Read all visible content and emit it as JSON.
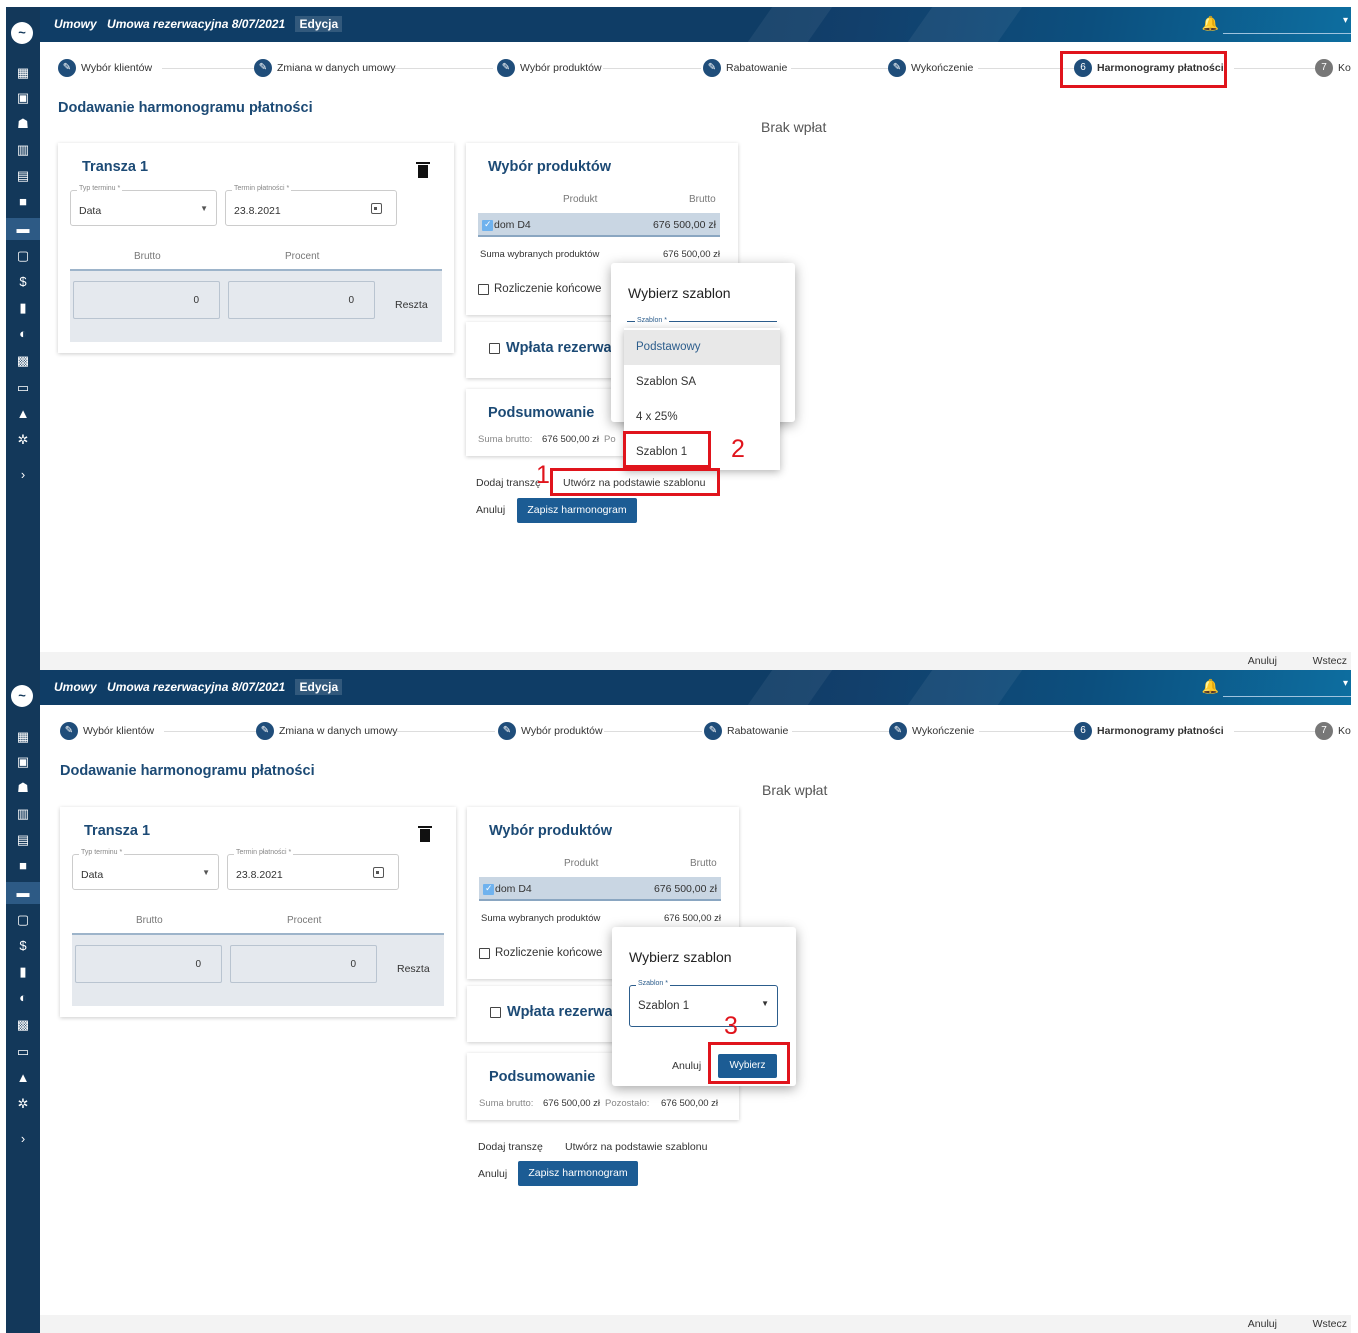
{
  "breadcrumb": {
    "root": "Umowy",
    "contract": "Umowa rezerwacyjna 8/07/2021",
    "mode": "Edycja"
  },
  "stepper": {
    "steps": [
      "Wybór klientów",
      "Zmiana w danych umowy",
      "Wybór produktów",
      "Rabatowanie",
      "Wykończenie",
      "Harmonogramy płatności",
      "Ko"
    ],
    "current_number": "6",
    "next_number": "7"
  },
  "page": {
    "title": "Dodawanie harmonogramu płatności",
    "no_payments": "Brak wpłat"
  },
  "tranche": {
    "title": "Transza 1",
    "term_type_label": "Typ terminu *",
    "term_type_value": "Data",
    "due_date_label": "Termin płatności *",
    "due_date_value": "23.8.2021",
    "col_brutto": "Brutto",
    "col_procent": "Procent",
    "brutto_value": "0",
    "procent_value": "0",
    "reszta_label": "Reszta"
  },
  "products": {
    "title": "Wybór produktów",
    "col_product": "Produkt",
    "col_brutto": "Brutto",
    "row_name": "dom D4",
    "row_value": "676 500,00 zł",
    "sum_label": "Suma wybranych produktów",
    "sum_value": "676 500,00 zł",
    "final_settlement": "Rozliczenie końcowe"
  },
  "reservation": {
    "title": "Wpłata rezerwa"
  },
  "summary": {
    "title": "Podsumowanie",
    "gross_label": "Suma brutto:",
    "gross_value": "676 500,00 zł",
    "remaining_label": "Pozostało:",
    "remaining_value": "676 500,00 zł",
    "remaining_label_cut": "Po"
  },
  "actions": {
    "add_tranche": "Dodaj transzę",
    "from_template": "Utwórz na podstawie szablonu",
    "cancel": "Anuluj",
    "save": "Zapisz harmonogram"
  },
  "footer": {
    "cancel": "Anuluj",
    "back": "Wstecz"
  },
  "dialog": {
    "title": "Wybierz szablon",
    "field_label": "Szablon *",
    "options": [
      "Podstawowy",
      "Szablon SA",
      "4 x 25%",
      "Szablon 1"
    ],
    "selected_value": "Szablon 1",
    "cancel": "Anuluj",
    "confirm": "Wybierz"
  },
  "annotations": {
    "one": "1",
    "two": "2",
    "three": "3"
  },
  "icons": {
    "sidebar": [
      "dashboard-icon",
      "calendar-icon",
      "people-icon",
      "building-icon",
      "store-icon",
      "briefcase-icon",
      "folder-icon",
      "inbox-icon",
      "dollar-icon",
      "document-icon",
      "pie-chart-icon",
      "bar-chart-icon",
      "card-icon",
      "warning-icon",
      "settings-icon",
      "chevron-right-icon"
    ]
  },
  "colors": {
    "primary": "#1c5c94",
    "sidebar": "#13385a",
    "annotation": "#e0141c"
  }
}
